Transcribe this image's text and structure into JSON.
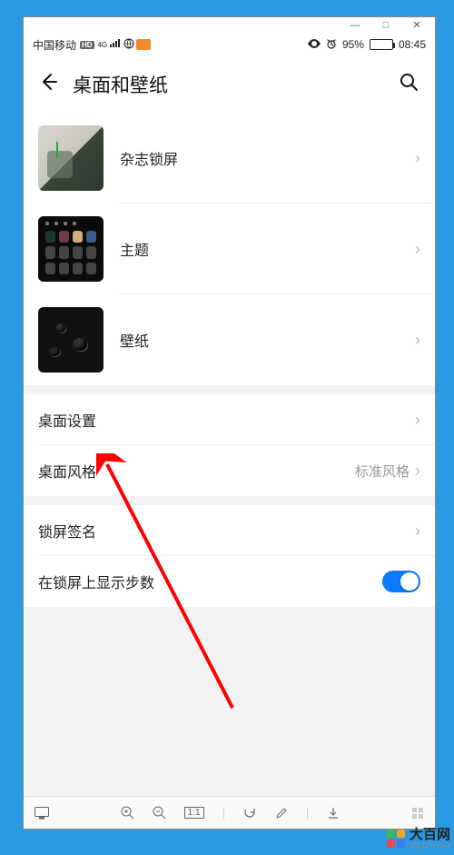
{
  "window_controls": {
    "min": "—",
    "max": "□",
    "close": "✕"
  },
  "status": {
    "carrier": "中国移动",
    "hd": "HD",
    "net": "4G",
    "battery_text": "95%",
    "time": "08:45"
  },
  "page": {
    "title": "桌面和壁纸"
  },
  "theme_rows": [
    {
      "label": "杂志锁屏"
    },
    {
      "label": "主题"
    },
    {
      "label": "壁纸"
    }
  ],
  "settings_rows": {
    "desktop_settings": "桌面设置",
    "style_label": "桌面风格",
    "style_value": "标准风格",
    "lock_sign": "锁屏签名",
    "show_steps": "在锁屏上显示步数"
  },
  "toolbar": {
    "scale": "1:1"
  },
  "watermark": {
    "title": "大百网",
    "url": "big100.net"
  }
}
